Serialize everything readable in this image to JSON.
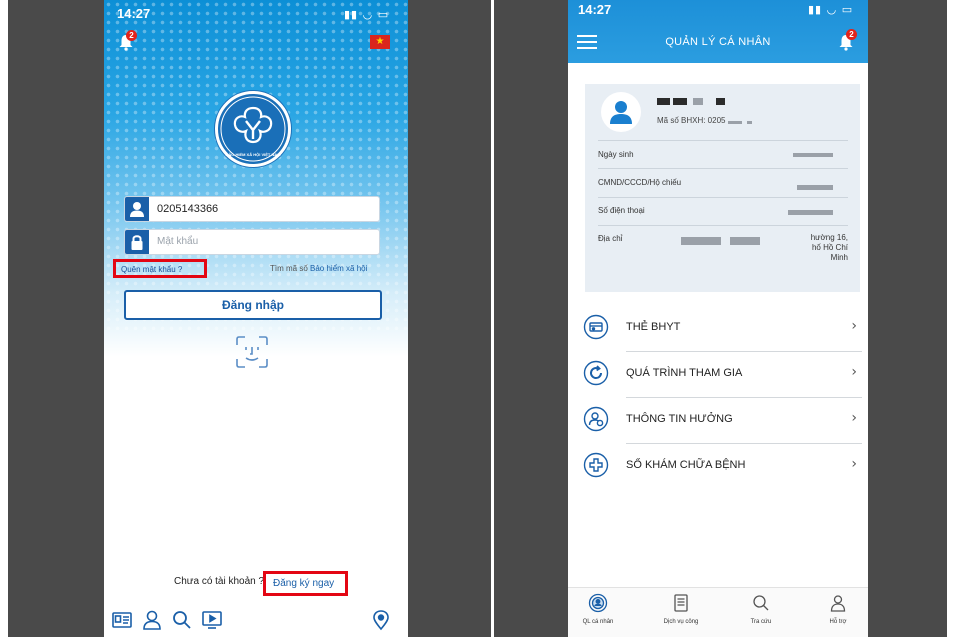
{
  "left_screen": {
    "status_time": "14:27",
    "status_icons": "▮▮ ◡ ▭",
    "notification_badge": "2",
    "flag_star": "★",
    "logo_text": "BẢO HIỂM XÃ HỘI VIỆT NAM",
    "username_value": "0205143366",
    "password_placeholder": "Mật khẩu",
    "forgot_password": "Quên mật khẩu ?",
    "lookup_prefix": "Tìm mã số ",
    "lookup_link": "Bảo hiểm xã hội",
    "login_button": "Đăng nhập",
    "no_account": "Chưa có tài khoản ?",
    "register_now": "Đăng ký ngay"
  },
  "right_screen": {
    "status_time": "14:27",
    "status_icons": "▮▮ ◡ ▭",
    "title": "QUẢN LÝ CÁ NHÂN",
    "notification_badge": "2",
    "profile": {
      "bhxh_label": "Mã số BHXH: 0205",
      "fields": [
        {
          "label": "Ngày sinh"
        },
        {
          "label": "CMND/CCCD/Hộ chiếu"
        },
        {
          "label": "Số điện thoại"
        },
        {
          "label": "Địa chỉ"
        }
      ],
      "address_tail": [
        "hường 16,",
        "hố Hồ Chí",
        "Minh"
      ]
    },
    "menu": [
      {
        "label": "THẺ BHYT",
        "icon": "card-icon"
      },
      {
        "label": "QUÁ TRÌNH THAM GIA",
        "icon": "refresh-icon"
      },
      {
        "label": "THÔNG TIN HƯỞNG",
        "icon": "person-info-icon"
      },
      {
        "label": "SỔ KHÁM CHỮA BỆNH",
        "icon": "medical-cross-icon"
      }
    ],
    "tabs": [
      {
        "label": "QL cá nhân",
        "icon": "personal-icon"
      },
      {
        "label": "Dịch vụ công",
        "icon": "document-icon"
      },
      {
        "label": "Tra cứu",
        "icon": "search-icon"
      },
      {
        "label": "Hỗ trợ",
        "icon": "support-icon"
      }
    ],
    "chevron": "›"
  },
  "colors": {
    "brand_blue": "#1a5fa8",
    "header_blue": "#1d90d8",
    "highlight_red": "#e30613"
  }
}
